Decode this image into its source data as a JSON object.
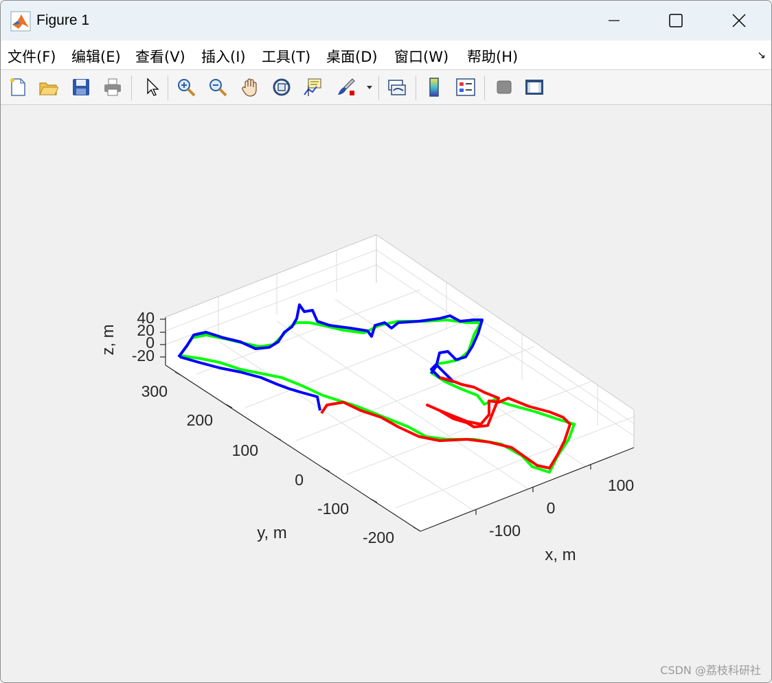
{
  "window": {
    "title": "Figure 1"
  },
  "menu": [
    {
      "label": "文件(F)"
    },
    {
      "label": "编辑(E)"
    },
    {
      "label": "查看(V)"
    },
    {
      "label": "插入(I)"
    },
    {
      "label": "工具(T)"
    },
    {
      "label": "桌面(D)"
    },
    {
      "label": "窗口(W)"
    },
    {
      "label": "帮助(H)"
    }
  ],
  "toolbar_icons": [
    "new-figure-icon",
    "open-file-icon",
    "save-icon",
    "print-icon",
    "select-arrow-icon",
    "zoom-in-icon",
    "zoom-out-icon",
    "pan-hand-icon",
    "rotate-3d-icon",
    "data-cursor-icon",
    "brush-icon",
    "link-plot-icon",
    "colorbar-icon",
    "legend-icon",
    "hide-plot-tools-icon",
    "show-plot-tools-icon"
  ],
  "chart_data": {
    "type": "line",
    "xlabel": "x, m",
    "ylabel": "y, m",
    "zlabel": "z, m",
    "x_ticks": [
      "-100",
      "0",
      "100"
    ],
    "y_ticks": [
      "-200",
      "-100",
      "0",
      "100",
      "200",
      "300"
    ],
    "z_ticks": [
      "-20",
      "0",
      "20",
      "40"
    ],
    "colors": {
      "series1": "#00ff00",
      "series2": "#0000ff",
      "series3": "#ff0000"
    },
    "grid": true
  },
  "watermark": "CSDN @荔枝科研社"
}
